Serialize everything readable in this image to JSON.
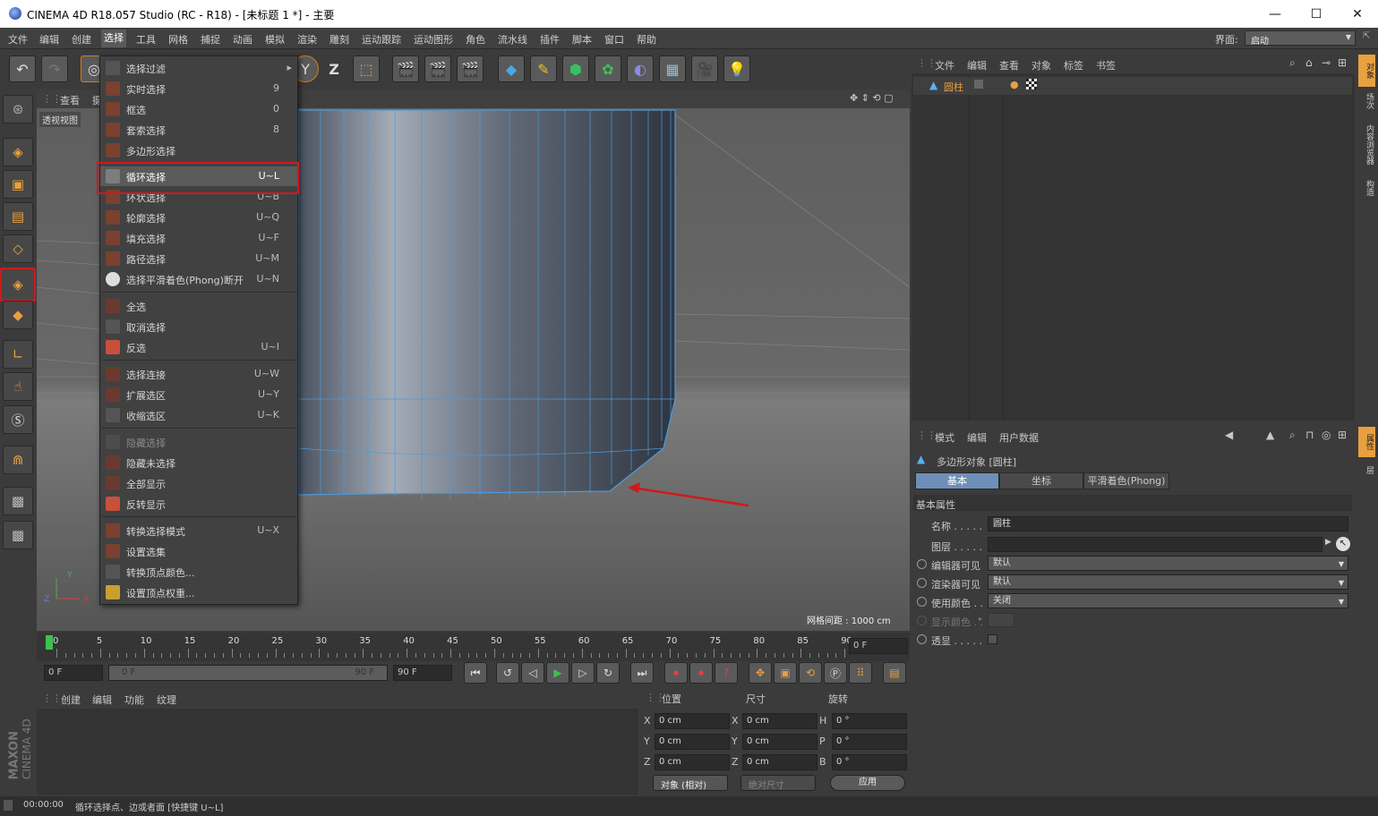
{
  "window": {
    "title": "CINEMA 4D R18.057 Studio (RC - R18) - [未标题 1 *] - 主要",
    "min_label": "—",
    "max_label": "☐",
    "close_label": "✕"
  },
  "menubar": {
    "items": [
      "文件",
      "编辑",
      "创建",
      "选择",
      "工具",
      "网格",
      "捕捉",
      "动画",
      "模拟",
      "渲染",
      "雕刻",
      "运动跟踪",
      "运动图形",
      "角色",
      "流水线",
      "插件",
      "脚本",
      "窗口",
      "帮助"
    ],
    "active": "选择",
    "layout_label": "界面:",
    "layout_value": "启动"
  },
  "toolbar": {
    "z_label": "Z",
    "y_label": "Y"
  },
  "viewport": {
    "menu": [
      "查看",
      "摄"
    ],
    "label": "透视视图",
    "grid_spacing": "网格间距 : 1000 cm"
  },
  "select_menu": {
    "items": [
      {
        "label": "选择过滤",
        "shortcut": "▸"
      },
      {
        "label": "实时选择",
        "shortcut": "9"
      },
      {
        "label": "框选",
        "shortcut": "0"
      },
      {
        "label": "套索选择",
        "shortcut": "8"
      },
      {
        "label": "多边形选择",
        "shortcut": ""
      },
      {
        "label": "循环选择",
        "shortcut": "U~L"
      },
      {
        "label": "环状选择",
        "shortcut": "U~B"
      },
      {
        "label": "轮廓选择",
        "shortcut": "U~Q"
      },
      {
        "label": "填充选择",
        "shortcut": "U~F"
      },
      {
        "label": "路径选择",
        "shortcut": "U~M"
      },
      {
        "label": "选择平滑着色(Phong)断开",
        "shortcut": "U~N"
      },
      {
        "label": "全选",
        "shortcut": ""
      },
      {
        "label": "取消选择",
        "shortcut": ""
      },
      {
        "label": "反选",
        "shortcut": "U~I"
      },
      {
        "label": "选择连接",
        "shortcut": "U~W"
      },
      {
        "label": "扩展选区",
        "shortcut": "U~Y"
      },
      {
        "label": "收缩选区",
        "shortcut": "U~K"
      },
      {
        "label": "隐藏选择",
        "shortcut": ""
      },
      {
        "label": "隐藏未选择",
        "shortcut": ""
      },
      {
        "label": "全部显示",
        "shortcut": ""
      },
      {
        "label": "反转显示",
        "shortcut": ""
      },
      {
        "label": "转换选择模式",
        "shortcut": "U~X"
      },
      {
        "label": "设置选集",
        "shortcut": ""
      },
      {
        "label": "转换顶点颜色...",
        "shortcut": ""
      },
      {
        "label": "设置顶点权重...",
        "shortcut": ""
      }
    ]
  },
  "timeline": {
    "ticks": [
      "0",
      "5",
      "10",
      "15",
      "20",
      "25",
      "30",
      "35",
      "40",
      "45",
      "50",
      "55",
      "60",
      "65",
      "70",
      "75",
      "80",
      "85",
      "90"
    ],
    "frame": "0 F"
  },
  "playbar": {
    "start": "0 F",
    "range_start": "0 F",
    "range_end": "90 F",
    "end": "90 F"
  },
  "material_manager": {
    "menu": [
      "创建",
      "编辑",
      "功能",
      "纹理"
    ]
  },
  "coords": {
    "headers": [
      "位置",
      "尺寸",
      "旋转"
    ],
    "rows": [
      {
        "a": "X",
        "av": "0 cm",
        "b": "X",
        "bv": "0 cm",
        "c": "H",
        "cv": "0 °"
      },
      {
        "a": "Y",
        "av": "0 cm",
        "b": "Y",
        "bv": "0 cm",
        "c": "P",
        "cv": "0 °"
      },
      {
        "a": "Z",
        "av": "0 cm",
        "b": "Z",
        "bv": "0 cm",
        "c": "B",
        "cv": "0 °"
      }
    ],
    "mode": "对象 (相对)",
    "size_mode": "绝对尺寸",
    "apply": "应用"
  },
  "status": {
    "time": "00:00:00",
    "message": "循环选择点、边或者面 [快捷键 U~L]"
  },
  "brand": {
    "maxon": "MAXON",
    "c4d": "CINEMA 4D"
  },
  "object_manager": {
    "menu": [
      "文件",
      "编辑",
      "查看",
      "对象",
      "标签",
      "书签"
    ],
    "object_name": "圆柱"
  },
  "attribute_manager": {
    "menu": [
      "模式",
      "编辑",
      "用户数据"
    ],
    "object_title": "多边形对象 [圆柱]",
    "tabs": [
      "基本",
      "坐标",
      "平滑着色(Phong)"
    ],
    "section": "基本属性",
    "fields": [
      {
        "label": "名称 . . . . .",
        "value": "圆柱"
      },
      {
        "label": "图层 . . . . .",
        "value": ""
      },
      {
        "label": "编辑器可见",
        "value": "默认"
      },
      {
        "label": "渲染器可见",
        "value": "默认"
      },
      {
        "label": "使用颜色 . .",
        "value": "关闭"
      },
      {
        "label": "显示颜色 . .",
        "value": ""
      },
      {
        "label": "透显 . . . . .",
        "value": ""
      }
    ]
  },
  "side_tabs": [
    "对象",
    "场次",
    "内容浏览器",
    "构造"
  ],
  "attr_side_tabs": [
    "属性",
    "层"
  ],
  "colors": {
    "accent_orange": "#e8a040",
    "highlight_red": "#d0191b",
    "tab_blue": "#6f8fb8",
    "wire_blue": "#4d9ad9"
  }
}
